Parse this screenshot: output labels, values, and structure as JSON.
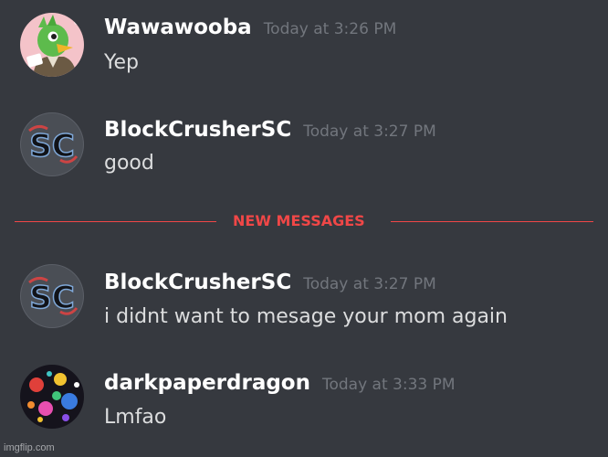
{
  "messages_group_1": [
    {
      "username": "Wawawooba",
      "timestamp": "Today at 3:26 PM",
      "content": "Yep",
      "avatar": "green-bird-avatar"
    },
    {
      "username": "BlockCrusherSC",
      "timestamp": "Today at 3:27 PM",
      "content": "good",
      "avatar": "sc-letters-avatar"
    }
  ],
  "divider": {
    "label": "NEW MESSAGES",
    "color": "#f04747"
  },
  "messages_group_2": [
    {
      "username": "BlockCrusherSC",
      "timestamp": "Today at 3:27 PM",
      "content": "i didnt want to mesage your mom again",
      "avatar": "sc-letters-avatar"
    },
    {
      "username": "darkpaperdragon",
      "timestamp": "Today at 3:33 PM",
      "content": "Lmfao",
      "avatar": "paint-splatter-avatar"
    }
  ],
  "watermark": "imgflip.com",
  "theme": {
    "background": "#36393f",
    "username_color": "#ffffff",
    "text_color": "#dcddde",
    "timestamp_color": "#72767d"
  }
}
